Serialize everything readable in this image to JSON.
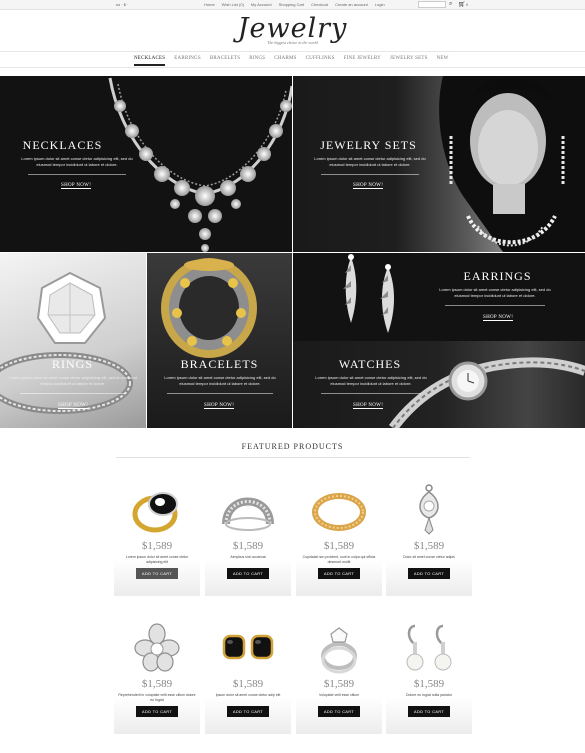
{
  "topbar": {
    "currency": "us · $ ·",
    "links": [
      "Home",
      "Wish List (0)",
      "My Account",
      "Shopping Cart",
      "Checkout",
      "Create an account",
      "Login"
    ],
    "cart_count": "0"
  },
  "brand": {
    "logo": "Jewelry",
    "tagline": "The biggest choice in the world"
  },
  "nav": {
    "items": [
      "NECKLACES",
      "EARRINGS",
      "BRACELETS",
      "RINGS",
      "CHARMS",
      "CUFFLINKS",
      "FINE JEWELRY",
      "JEWELRY SETS",
      "NEW"
    ],
    "active_index": 0
  },
  "banners": {
    "necklaces": {
      "title": "NECKLACES",
      "desc": "Lorem ipsum dolor sit amet conse ctetur adipisicing elit, sed do eiusmod tempor incididunt ut labore et dolore.",
      "cta": "SHOP NOW!"
    },
    "jewelry_sets": {
      "title": "JEWELRY SETS",
      "desc": "Lorem ipsum dolor sit amet conse ctetur adipisicing elit, sed do eiusmod tempor incididunt ut labore et dolore.",
      "cta": "SHOP NOW!"
    },
    "earrings": {
      "title": "EARRINGS",
      "desc": "Lorem ipsum dolor sit amet conse ctetur adipisicing elit, sed do eiusmod tempor incididunt ut labore et dolore.",
      "cta": "SHOP NOW!"
    },
    "rings": {
      "title": "RINGS",
      "desc": "Lorem ipsum dolor sit amet conse ctetur adipisicing elit, sed do eiusmod tempor incididunt ut labore et dolore.",
      "cta": "SHOP NOW!"
    },
    "bracelets": {
      "title": "BRACELETS",
      "desc": "Lorem ipsum dolor sit amet conse ctetur adipisicing elit, sed do eiusmod tempor incididunt ut labore et dolore.",
      "cta": "SHOP NOW!"
    },
    "watches": {
      "title": "WATCHES",
      "desc": "Lorem ipsum dolor sit amet conse ctetur adipisicing elit, sed do eiusmod tempor incididunt ut labore et dolore.",
      "cta": "SHOP NOW!"
    }
  },
  "featured": {
    "title": "FEATURED PRODUCTS",
    "products": [
      {
        "price": "$1,589",
        "desc": "Lorem ipsum dolor sit amet conse ctetur adipisicing elit",
        "button": "ADD TO CART",
        "icon": "gold-onyx-ring-icon"
      },
      {
        "price": "$1,589",
        "desc": "Aenpbus sint occaecat",
        "button": "ADD TO CART",
        "icon": "silver-cuff-icon"
      },
      {
        "price": "$1,589",
        "desc": "Cupidatat non proident, sunt in culpa qui officia deserunt mollit",
        "button": "ADD TO CART",
        "icon": "gold-bracelet-icon"
      },
      {
        "price": "$1,589",
        "desc": "Dolor sit amet conse ctetur adipis",
        "button": "ADD TO CART",
        "icon": "diamond-pendant-icon"
      },
      {
        "price": "$1,589",
        "desc": "Reprehenderit in voluptate velit esse cillum dolore eu fugiat",
        "button": "ADD TO CART",
        "icon": "flower-brooch-icon"
      },
      {
        "price": "$1,589",
        "desc": "Ipsum dolor sit amet conse ctetur adip elit",
        "button": "ADD TO CART",
        "icon": "black-stud-earrings-icon"
      },
      {
        "price": "$1,589",
        "desc": "Voluptate velit esse cillum",
        "button": "ADD TO CART",
        "icon": "diamond-ring-set-icon"
      },
      {
        "price": "$1,589",
        "desc": "Dolore eu fugiat nulla pariatur",
        "button": "ADD TO CART",
        "icon": "pearl-drop-earrings-icon"
      }
    ]
  },
  "colors": {
    "banner_dark": "#121212",
    "button": "#111111",
    "price": "#888888"
  }
}
